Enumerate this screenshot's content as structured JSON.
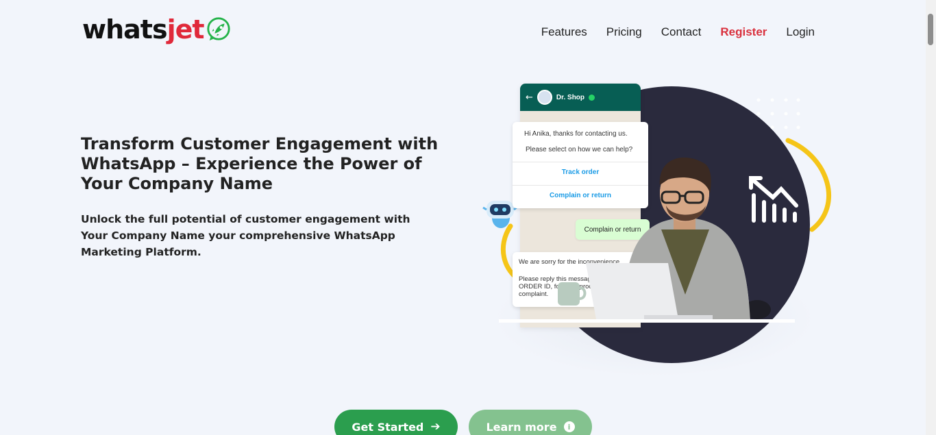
{
  "logo": {
    "part1": "whats",
    "part2": "jet",
    "badge_icon": "rocket-icon"
  },
  "nav": {
    "features": "Features",
    "pricing": "Pricing",
    "contact": "Contact",
    "register": "Register",
    "login": "Login"
  },
  "hero": {
    "title": "Transform Customer Engagement with WhatsApp – Experience the Power of Your Company Name",
    "subtitle": "Unlock the full potential of customer engagement with Your Company Name your comprehensive WhatsApp Marketing Platform."
  },
  "chat": {
    "contact_name": "Dr. Shop",
    "greeting_line1": "Hi Anika, thanks for contacting us.",
    "greeting_line2": "Please select on how we can help?",
    "option1": "Track order",
    "option2": "Complain or return",
    "reply": "Complain or return",
    "response_line1": "We are sorry for the inconvenience.",
    "response_line2": "Please reply this message with your ORDER ID, for us to process your complaint."
  },
  "cta": {
    "primary_label": "Get Started",
    "primary_icon": "arrow-right-icon",
    "secondary_label": "Learn more",
    "secondary_icon": "info-icon"
  },
  "colors": {
    "background": "#f2f5fb",
    "brand_red": "#e0293a",
    "brand_green": "#2b9e4e",
    "whatsapp_header": "#075e54",
    "circle_dark": "#2a2a3d",
    "accent_yellow": "#f5c518"
  }
}
